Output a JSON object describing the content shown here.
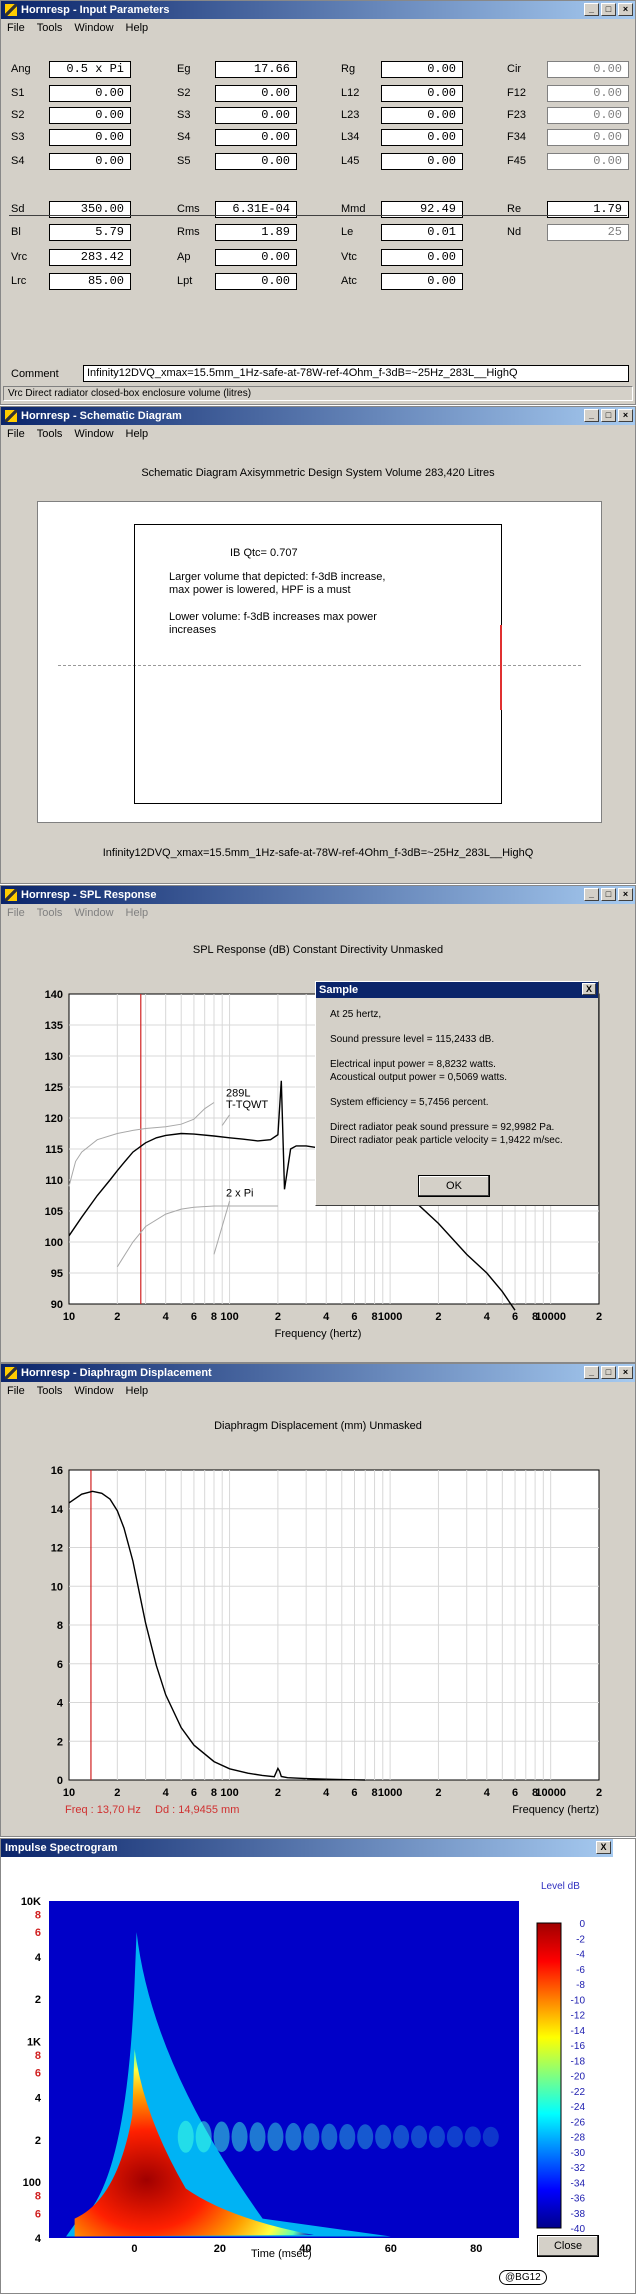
{
  "input_window": {
    "title": "Hornresp - Input Parameters",
    "menu": [
      "File",
      "Tools",
      "Window",
      "Help"
    ],
    "rows1": [
      [
        [
          "Ang",
          "0.5 x Pi",
          false
        ],
        [
          "Eg",
          "17.66",
          false
        ],
        [
          "Rg",
          "0.00",
          false
        ],
        [
          "Cir",
          "0.00",
          true
        ]
      ],
      [
        [
          "S1",
          "0.00",
          false
        ],
        [
          "S2",
          "0.00",
          false
        ],
        [
          "L12",
          "0.00",
          false
        ],
        [
          "F12",
          "0.00",
          true
        ]
      ],
      [
        [
          "S2",
          "0.00",
          false
        ],
        [
          "S3",
          "0.00",
          false
        ],
        [
          "L23",
          "0.00",
          false
        ],
        [
          "F23",
          "0.00",
          true
        ]
      ],
      [
        [
          "S3",
          "0.00",
          false
        ],
        [
          "S4",
          "0.00",
          false
        ],
        [
          "L34",
          "0.00",
          false
        ],
        [
          "F34",
          "0.00",
          true
        ]
      ],
      [
        [
          "S4",
          "0.00",
          false
        ],
        [
          "S5",
          "0.00",
          false
        ],
        [
          "L45",
          "0.00",
          false
        ],
        [
          "F45",
          "0.00",
          true
        ]
      ]
    ],
    "rows2": [
      [
        [
          "Sd",
          "350.00",
          false
        ],
        [
          "Cms",
          "6.31E-04",
          false
        ],
        [
          "Mmd",
          "92.49",
          false
        ],
        [
          "Re",
          "1.79",
          false
        ]
      ],
      [
        [
          "Bl",
          "5.79",
          false
        ],
        [
          "Rms",
          "1.89",
          false
        ],
        [
          "Le",
          "0.01",
          false
        ],
        [
          "Nd",
          "25",
          true
        ]
      ],
      [
        [
          "Vrc",
          "283.42",
          false
        ],
        [
          "Ap",
          "0.00",
          false
        ],
        [
          "Vtc",
          "0.00",
          false
        ]
      ],
      [
        [
          "Lrc",
          "85.00",
          false
        ],
        [
          "Lpt",
          "0.00",
          false
        ],
        [
          "Atc",
          "0.00",
          false
        ]
      ]
    ],
    "comment_label": "Comment",
    "comment_value": "Infinity12DVQ_xmax=15.5mm_1Hz-safe-at-78W-ref-4Ohm_f-3dB=~25Hz_283L__HighQ",
    "status": "Vrc   Direct radiator closed-box enclosure volume  (litres)"
  },
  "schematic_window": {
    "title": "Hornresp - Schematic Diagram",
    "menu": [
      "File",
      "Tools",
      "Window",
      "Help"
    ],
    "heading": "Schematic Diagram    Axisymmetric Design    System Volume 283,420 Litres",
    "box_title": "IB Qtc= 0.707",
    "box_text1a": "Larger volume that depicted: f-3dB increase,",
    "box_text1b": "max power is lowered, HPF is a must",
    "box_text2a": "Lower volume: f-3dB increases max power",
    "box_text2b": "increases",
    "caption": "Infinity12DVQ_xmax=15.5mm_1Hz-safe-at-78W-ref-4Ohm_f-3dB=~25Hz_283L__HighQ"
  },
  "spl_window": {
    "title": "Hornresp - SPL Response",
    "menu": [
      "File",
      "Tools",
      "Window",
      "Help"
    ],
    "heading": "SPL Response (dB)    Constant Directivity    Unmasked",
    "xlabel": "Frequency (hertz)",
    "annotation_1a": "289L",
    "annotation_1b": "T-TQWT",
    "annotation_2": "2 x Pi"
  },
  "sample_dialog": {
    "title": "Sample",
    "close": "X",
    "line1": "At 25 hertz,",
    "line2": "Sound pressure level = 115,2433 dB.",
    "line3": "Electrical input power = 8,8232 watts.",
    "line4": "Acoustical output power = 0,5069 watts.",
    "line5": "System efficiency = 5,7456 percent.",
    "line6": "Direct radiator peak sound pressure = 92,9982 Pa.",
    "line7": "Direct radiator peak particle velocity = 1,9422 m/sec.",
    "ok": "OK"
  },
  "disp_window": {
    "title": "Hornresp - Diaphragm Displacement",
    "menu": [
      "File",
      "Tools",
      "Window",
      "Help"
    ],
    "heading": "Diaphragm Displacement (mm)    Unmasked",
    "xlabel": "Frequency (hertz)",
    "freq_readout": "Freq : 13,70 Hz",
    "dd_readout": "Dd : 14,9455 mm"
  },
  "spectro_window": {
    "title": "Impulse Spectrogram",
    "close": "X",
    "level_label": "Level  dB",
    "xlabel": "Time (msec)",
    "close_button": "Close",
    "badge": "@BG12"
  },
  "chart_data": [
    {
      "type": "line",
      "title": "SPL Response (dB)",
      "xlabel": "Frequency (hertz)",
      "ylabel": "",
      "xscale": "log",
      "xlim": [
        10,
        20000
      ],
      "ylim": [
        90,
        140
      ],
      "x_tick_labels": [
        "10",
        "2",
        "4",
        "6",
        "8",
        "100",
        "2",
        "4",
        "6",
        "8",
        "1000",
        "2",
        "4",
        "6",
        "8",
        "10000",
        "2"
      ],
      "y_ticks": [
        90,
        95,
        100,
        105,
        110,
        115,
        120,
        125,
        130,
        135,
        140
      ],
      "series": [
        {
          "x": [
            10,
            12,
            15,
            18,
            20,
            22,
            25,
            30,
            35,
            40,
            50,
            60,
            80,
            100,
            120,
            150,
            180,
            200,
            210,
            220,
            240,
            260,
            300,
            400,
            500,
            700,
            1000,
            1500,
            2000,
            3000,
            4000,
            5000,
            6000
          ],
          "y": [
            101,
            104,
            107.5,
            110,
            111.5,
            112.8,
            114.5,
            116,
            116.8,
            117.2,
            117.5,
            117.4,
            117.1,
            116.8,
            116.6,
            116.3,
            116.5,
            117.3,
            126,
            108.5,
            115,
            115.5,
            115.5,
            115,
            114,
            112.5,
            110,
            106,
            103,
            98,
            95,
            92,
            89
          ]
        },
        {
          "x": [
            10,
            11,
            12,
            15,
            20,
            25,
            30,
            40,
            50,
            60,
            70,
            80
          ],
          "y": [
            109,
            113,
            114.5,
            116.5,
            117.5,
            118,
            118.3,
            118.6,
            119,
            119.8,
            121.5,
            122.5
          ]
        },
        {
          "x": [
            20,
            25,
            30,
            40,
            50,
            60,
            80,
            100,
            150,
            200
          ],
          "y": [
            96,
            100,
            102.5,
            104.5,
            105.3,
            105.6,
            105.8,
            105.8,
            105.8,
            105.8
          ]
        }
      ],
      "marker_x": 28
    },
    {
      "type": "line",
      "title": "Diaphragm Displacement (mm)",
      "xlabel": "Frequency (hertz)",
      "xscale": "log",
      "xlim": [
        10,
        20000
      ],
      "ylim": [
        0,
        16
      ],
      "y_ticks": [
        0,
        2,
        4,
        6,
        8,
        10,
        12,
        14,
        16
      ],
      "x_tick_labels": [
        "10",
        "2",
        "4",
        "6",
        "8",
        "100",
        "2",
        "4",
        "6",
        "8",
        "1000",
        "2",
        "4",
        "6",
        "8",
        "10000",
        "2"
      ],
      "series": [
        {
          "x": [
            10,
            12,
            14,
            16,
            18,
            20,
            22,
            25,
            28,
            30,
            35,
            40,
            50,
            60,
            80,
            100,
            130,
            160,
            190,
            200,
            205,
            210,
            230,
            300,
            400,
            500,
            600,
            700
          ],
          "y": [
            14.3,
            14.75,
            14.9,
            14.8,
            14.5,
            13.9,
            13,
            11.3,
            9.3,
            8.1,
            5.9,
            4.4,
            2.7,
            1.8,
            0.95,
            0.58,
            0.35,
            0.24,
            0.17,
            0.6,
            0.45,
            0.18,
            0.12,
            0.07,
            0.04,
            0.02,
            0.01,
            0.0
          ]
        }
      ],
      "marker_x": 13.7
    },
    {
      "type": "heatmap",
      "title": "Impulse Spectrogram",
      "xlabel": "Time (msec)",
      "xlim": [
        -20,
        90
      ],
      "x_ticks": [
        0,
        20,
        40,
        60,
        80
      ],
      "yscale": "log",
      "ylim": [
        40,
        10000
      ],
      "y_tick_labels": [
        "10K",
        "8",
        "6",
        "4",
        "2",
        "1K",
        "8",
        "6",
        "4",
        "2",
        "100",
        "8",
        "6",
        "4"
      ],
      "colorbar_label": "Level  dB",
      "colorbar_ticks": [
        0,
        -2,
        -4,
        -6,
        -8,
        -10,
        -12,
        -14,
        -16,
        -18,
        -20,
        -22,
        -24,
        -26,
        -28,
        -30,
        -32,
        -34,
        -36,
        -38,
        -40
      ],
      "colors": [
        "#a00000",
        "#ff0000",
        "#ff8000",
        "#ffff00",
        "#80ff80",
        "#00ffff",
        "#0080ff",
        "#0000ff",
        "#00008b"
      ]
    }
  ]
}
